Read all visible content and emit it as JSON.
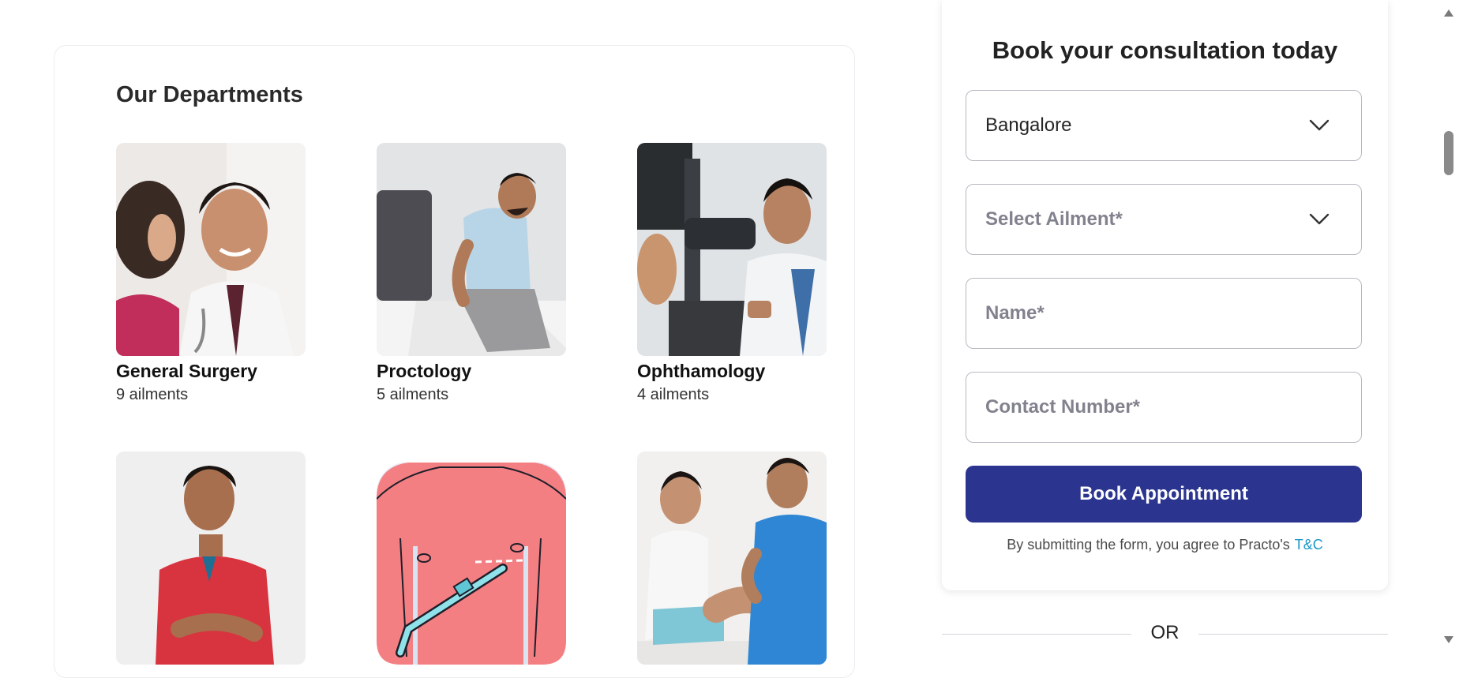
{
  "departments": {
    "title": "Our Departments",
    "items": [
      {
        "name": "General Surgery",
        "count": "9 ailments"
      },
      {
        "name": "Proctology",
        "count": "5 ailments"
      },
      {
        "name": "Ophthamology",
        "count": "4 ailments"
      },
      {
        "name": "",
        "count": ""
      },
      {
        "name": "",
        "count": ""
      },
      {
        "name": "",
        "count": ""
      }
    ]
  },
  "form": {
    "title": "Book your consultation today",
    "city_value": "Bangalore",
    "ailment_placeholder": "Select Ailment*",
    "name_placeholder": "Name*",
    "contact_placeholder": "Contact Number*",
    "submit_label": "Book Appointment",
    "terms_text": "By submitting the form, you agree to Practo's",
    "terms_link": "T&C"
  },
  "or_label": "OR",
  "colors": {
    "primary_button": "#2b3590",
    "link": "#1a97c9"
  }
}
